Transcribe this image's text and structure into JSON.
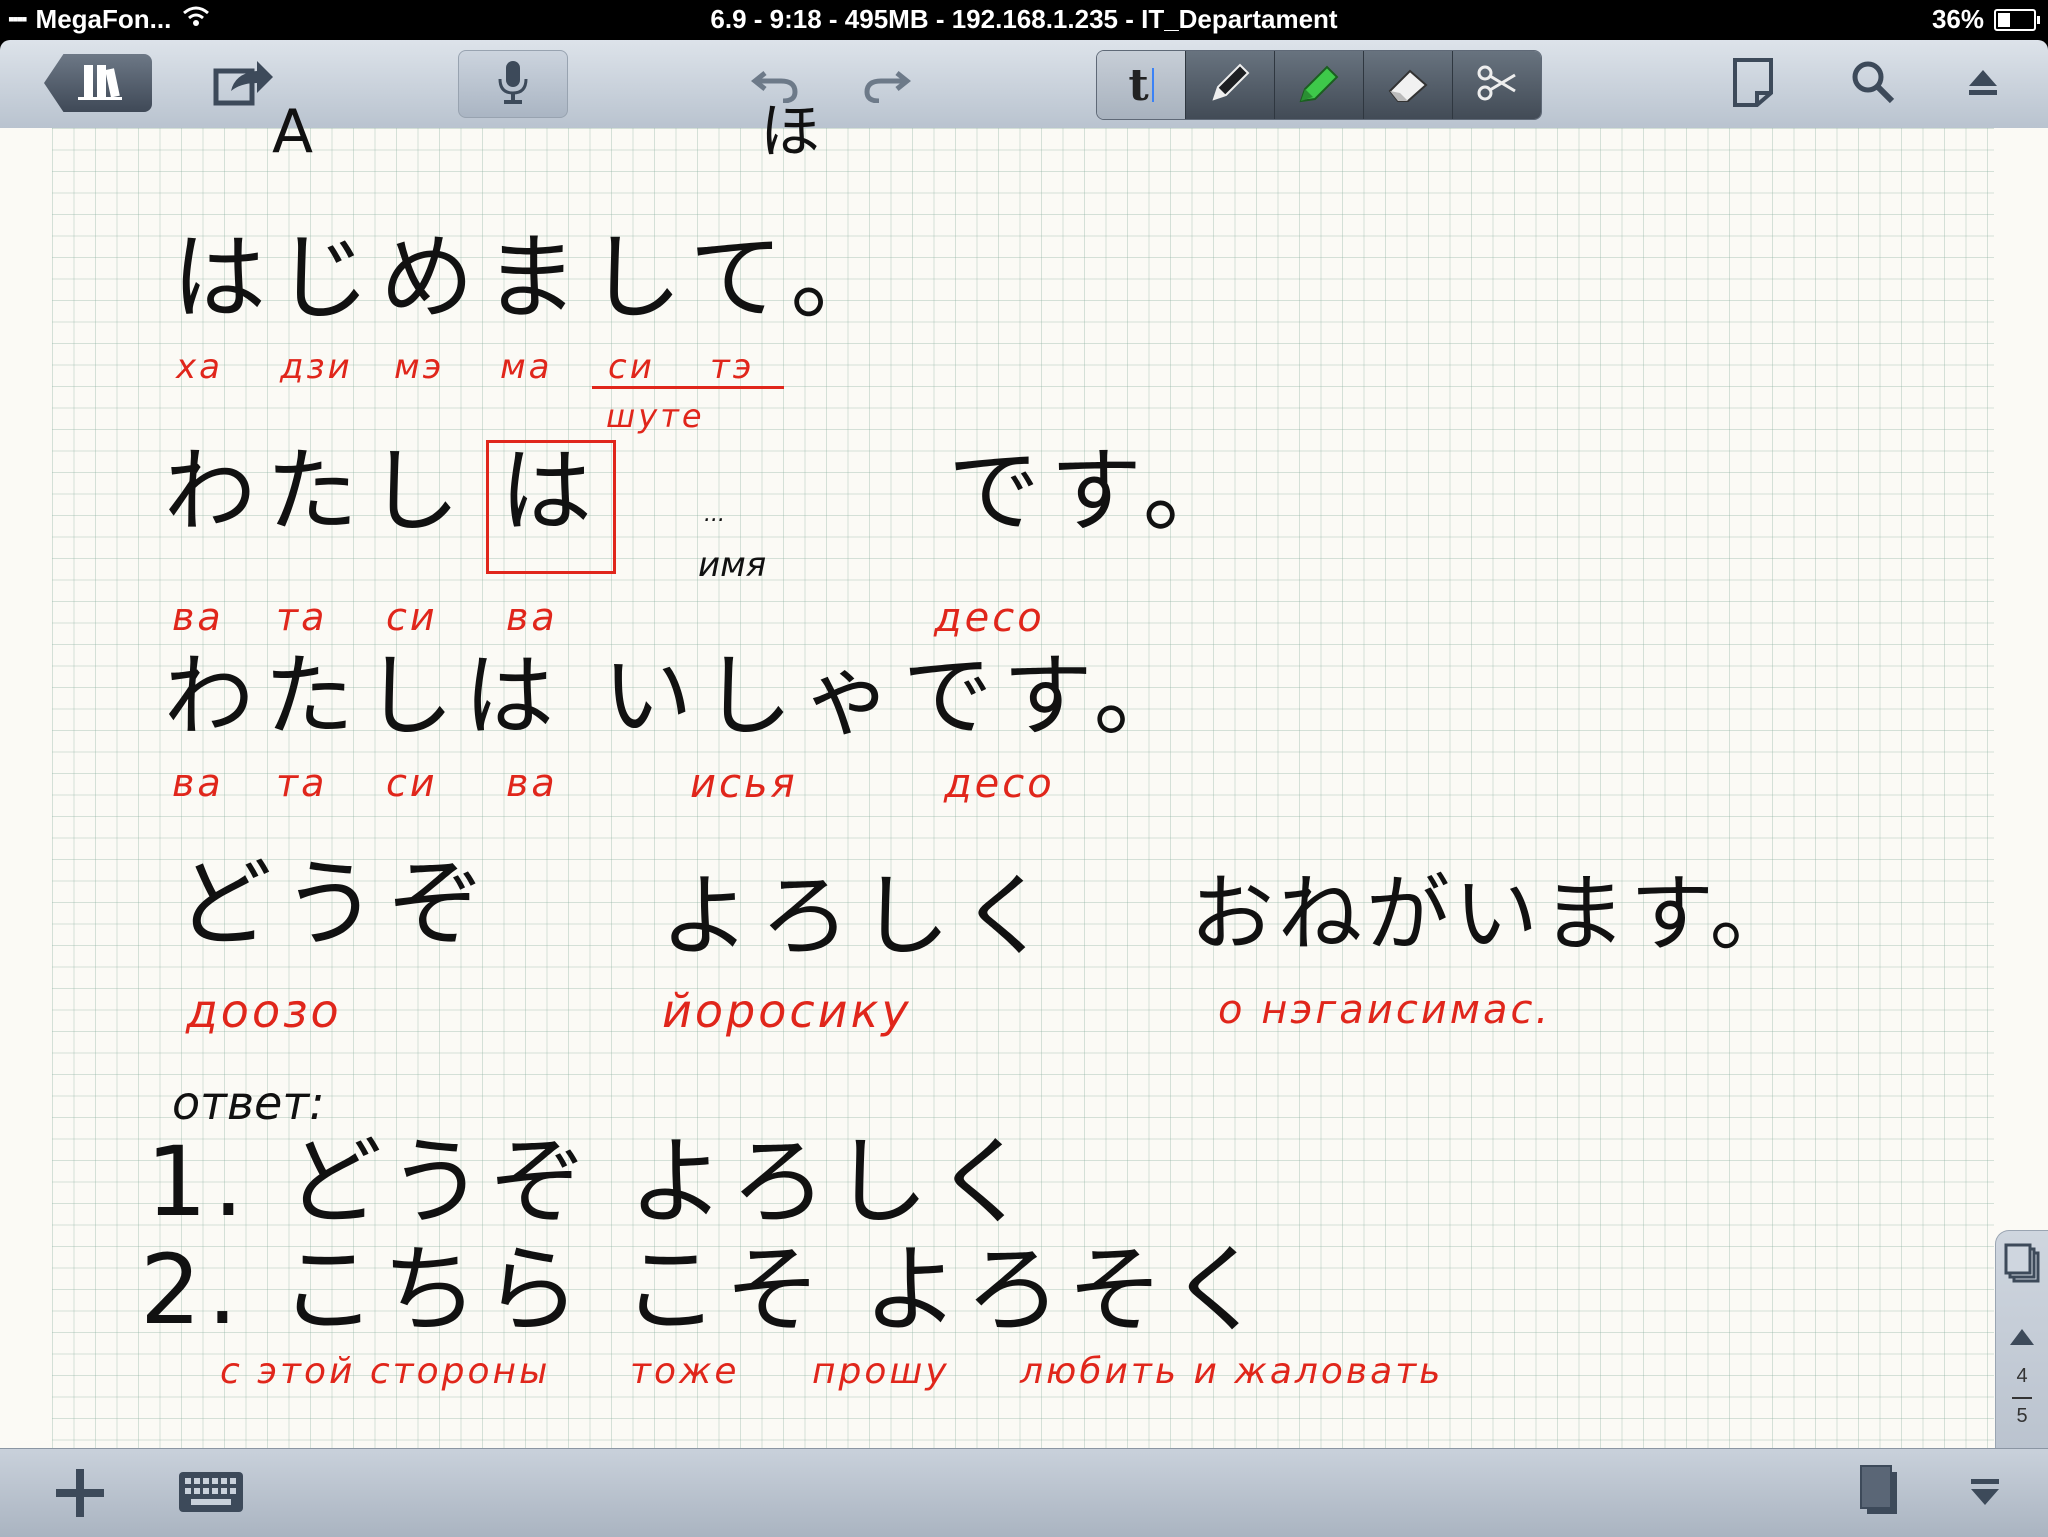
{
  "status_bar": {
    "carrier": "MegaFon...",
    "center_text": "6.9 - 9:18 - 495MB - 192.168.1.235 - IT_Departament",
    "battery": "36%",
    "battery_level": 0.36
  },
  "toolbar": {
    "library_icon": "library-books-icon",
    "share_icon": "share-arrow-icon",
    "mic_icon": "microphone-icon",
    "undo_icon": "undo-icon",
    "redo_icon": "redo-icon",
    "text_tool_label": "t",
    "tools": [
      "text-tool",
      "pen-tool",
      "highlighter-tool",
      "eraser-tool",
      "scissors-tool"
    ],
    "active_tool": "text-tool",
    "new_page_icon": "new-page-icon",
    "search_icon": "search-icon",
    "eject_icon": "eject-icon"
  },
  "notes": {
    "top_fragment_a": "A",
    "top_fragment_b": "ほ",
    "line1_jp": "はじめまして。",
    "line1_ru": [
      "ха",
      "дзи",
      "мэ",
      "ма",
      "си",
      "тэ"
    ],
    "line1_ru_correction": "шуте",
    "line2_jp_a": "わたし",
    "line2_jp_boxed": "は",
    "line2_dots": "...",
    "line2_name_label": "имя",
    "line2_jp_b": "です。",
    "line2_ru": [
      "ва",
      "та",
      "си",
      "ва"
    ],
    "line2_ru_des": "десо",
    "line3_jp": "わたしは いしゃです。",
    "line3_ru": [
      "ва",
      "та",
      "си",
      "ва"
    ],
    "line3_ru_isya": "исья",
    "line3_ru_des": "десо",
    "line4_jp_a": "どうぞ",
    "line4_jp_b": "よろしく",
    "line4_jp_c": "おねがいます。",
    "line4_ru_a": "доозо",
    "line4_ru_b": "йоросику",
    "line4_ru_c": "о нэгаисимас.",
    "answer_label": "ответ:",
    "answer1": "1. どうぞ よろしく",
    "answer2": "2. こちら こそ よろそく",
    "answer2_ru": [
      "с этой стороны",
      "тоже",
      "прошу",
      "любить и жаловать"
    ]
  },
  "side_pager": {
    "current_page": "4",
    "total_pages": "5",
    "pages_icon": "pages-stack-icon",
    "up_icon": "page-up-arrow-icon",
    "down_icon": "page-down-arrow-icon"
  },
  "bottom_bar": {
    "add_icon": "plus-icon",
    "keyboard_icon": "keyboard-icon",
    "documents_icon": "documents-icon",
    "collapse_icon": "collapse-down-icon"
  }
}
